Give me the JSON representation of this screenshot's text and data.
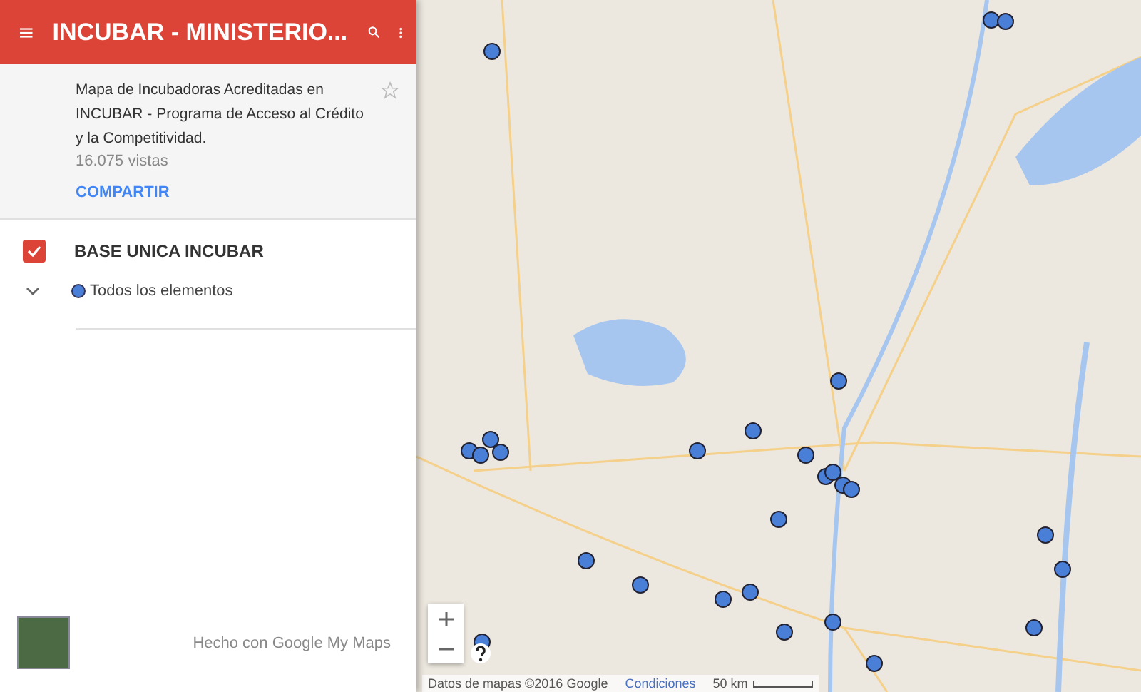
{
  "header": {
    "title": "INCUBAR - MINISTERIO..."
  },
  "info": {
    "description": "Mapa de Incubadoras Acreditadas en INCUBAR - Programa de Acceso al Crédito y la Competitividad.",
    "views": "16.075 vistas",
    "share": "COMPARTIR",
    "starred": false
  },
  "layers": [
    {
      "name": "BASE UNICA INCUBAR",
      "checked": true,
      "expanded": true,
      "items": [
        {
          "label": "Todos los elementos",
          "color": "#4a7fd8"
        }
      ]
    }
  ],
  "footer": {
    "made_with": "Hecho con Google My Maps"
  },
  "map": {
    "attribution": "Datos de mapas ©2016 Google",
    "terms": "Condiciones",
    "scale": "50 km"
  }
}
